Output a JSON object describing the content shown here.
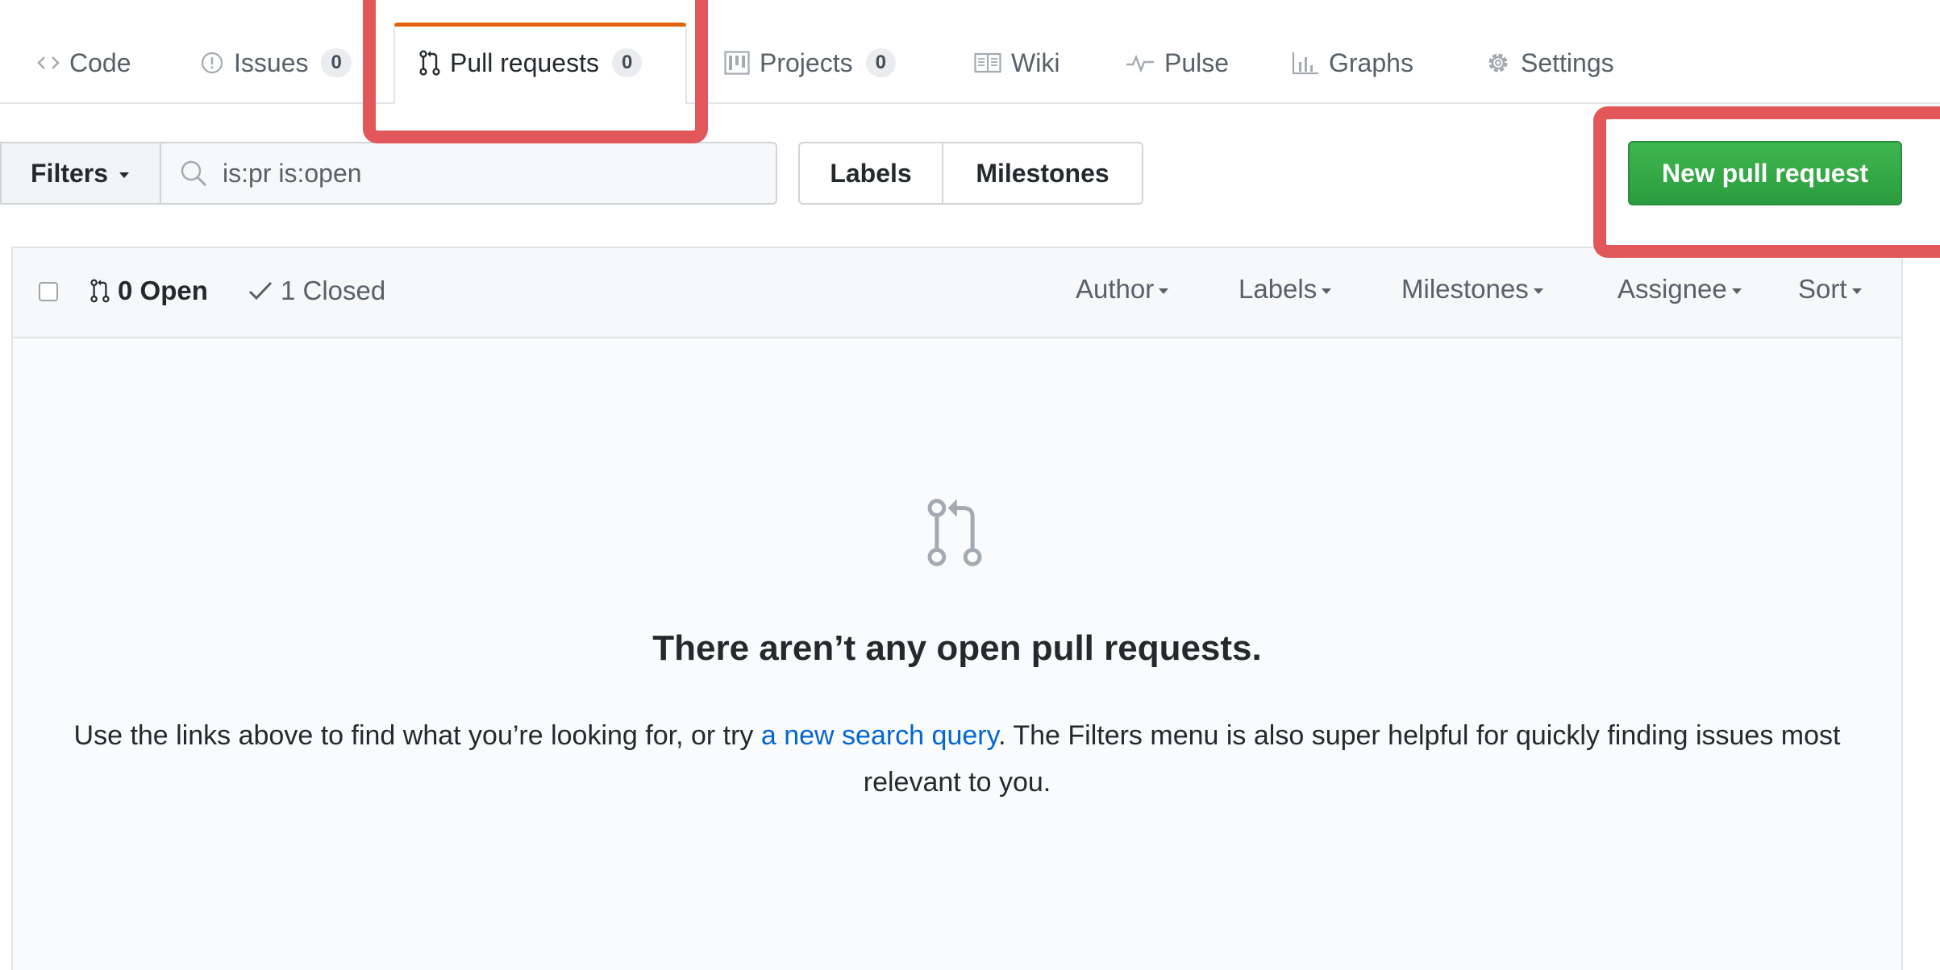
{
  "tabs": [
    {
      "label": "Code",
      "icon": "code-icon"
    },
    {
      "label": "Issues",
      "count": "0",
      "icon": "issue-opened-icon"
    },
    {
      "label": "Pull requests",
      "count": "0",
      "icon": "git-pull-request-icon"
    },
    {
      "label": "Projects",
      "count": "0",
      "icon": "project-icon"
    },
    {
      "label": "Wiki",
      "icon": "book-icon"
    },
    {
      "label": "Pulse",
      "icon": "pulse-icon"
    },
    {
      "label": "Graphs",
      "icon": "graph-icon"
    },
    {
      "label": "Settings",
      "icon": "gear-icon"
    }
  ],
  "toolbar": {
    "filters_label": "Filters",
    "search_value": "is:pr is:open",
    "labels_label": "Labels",
    "milestones_label": "Milestones",
    "new_pr_label": "New pull request"
  },
  "list_header": {
    "open_label": "0 Open",
    "closed_label": "1 Closed",
    "filters": [
      "Author",
      "Labels",
      "Milestones",
      "Assignee",
      "Sort"
    ]
  },
  "blankslate": {
    "title": "There aren’t any open pull requests.",
    "text_before": "Use the links above to find what you’re looking for, or try ",
    "link": "a new search query",
    "text_after": ". The Filters menu is also super helpful for quickly finding issues most relevant to you."
  },
  "colors": {
    "accent_orange": "#e36209",
    "primary_green": "#2ea44f",
    "link_blue": "#0366d6",
    "annotation_red": "#e1575a"
  }
}
